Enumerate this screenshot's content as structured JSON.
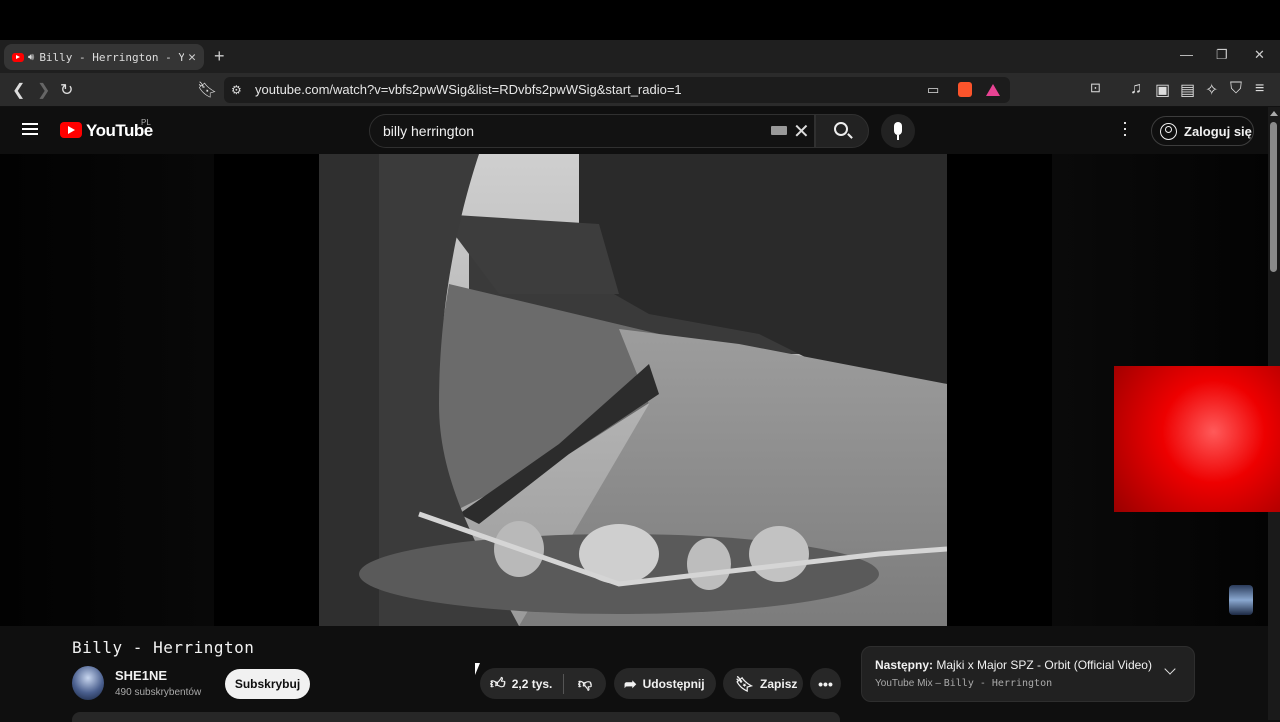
{
  "browser": {
    "tab_title": "Billy - Herrington - YouTube",
    "url": "youtube.com/watch?v=vbfs2pwWSig&list=RDvbfs2pwWSig&start_radio=1"
  },
  "youtube": {
    "logo_text": "YouTube",
    "region": "PL",
    "search_value": "billy herrington",
    "login_label": "Zaloguj się"
  },
  "video": {
    "title": "Billy - Herrington",
    "channel_name": "SHE1NE",
    "subscribers": "490 subskrybentów",
    "subscribe_label": "Subskrybuj",
    "likes": "2,2 tys.",
    "share_label": "Udostępnij",
    "save_label": "Zapisz"
  },
  "up_next": {
    "prefix": "Następny:",
    "title": "Majki x Major SPZ - Orbit (Official Video)",
    "source": "YouTube Mix –",
    "playlist": "Billy - Herrington"
  },
  "colors": {
    "brand_red": "#ff0000",
    "background": "#0f0f0f"
  },
  "icons": [
    "back-icon",
    "forward-icon",
    "reload-icon",
    "bookmark-icon",
    "site-settings-icon",
    "cast-icon",
    "brave-shield-icon",
    "brave-rewards-icon",
    "menu-icon",
    "search-icon",
    "mic-icon",
    "like-icon",
    "dislike-icon",
    "share-icon",
    "save-icon"
  ]
}
